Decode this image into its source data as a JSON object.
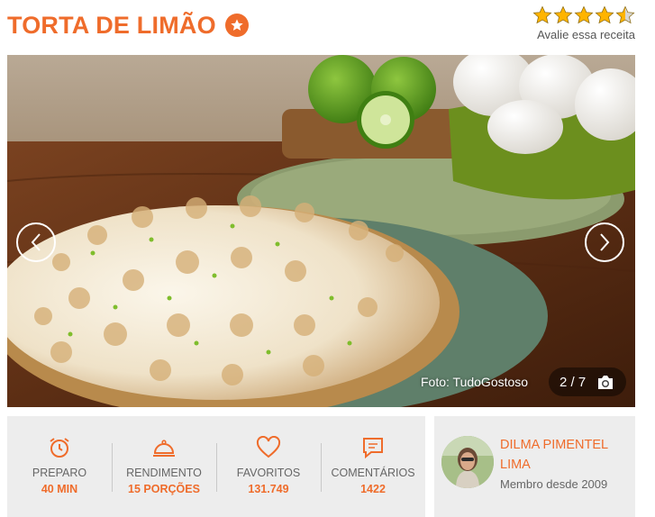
{
  "recipe": {
    "title": "TORTA DE LIMÃO",
    "rating_value": 4.5,
    "rating_max": 5,
    "rate_label": "Avalie essa receita"
  },
  "photo": {
    "credit": "Foto: TudoGostoso",
    "counter": "2 / 7"
  },
  "stats": [
    {
      "icon": "alarm-clock-icon",
      "label": "PREPARO",
      "value": "40 MIN"
    },
    {
      "icon": "serving-cloche-icon",
      "label": "RENDIMENTO",
      "value": "15 PORÇÕES"
    },
    {
      "icon": "heart-icon",
      "label": "FAVORITOS",
      "value": "131.749"
    },
    {
      "icon": "comment-icon",
      "label": "COMENTÁRIOS",
      "value": "1422"
    }
  ],
  "author": {
    "name": "DILMA PIMENTEL LIMA",
    "since": "Membro desde 2009"
  },
  "colors": {
    "accent": "#ef6c2b",
    "star": "#ffb400",
    "panel": "#ededed"
  }
}
